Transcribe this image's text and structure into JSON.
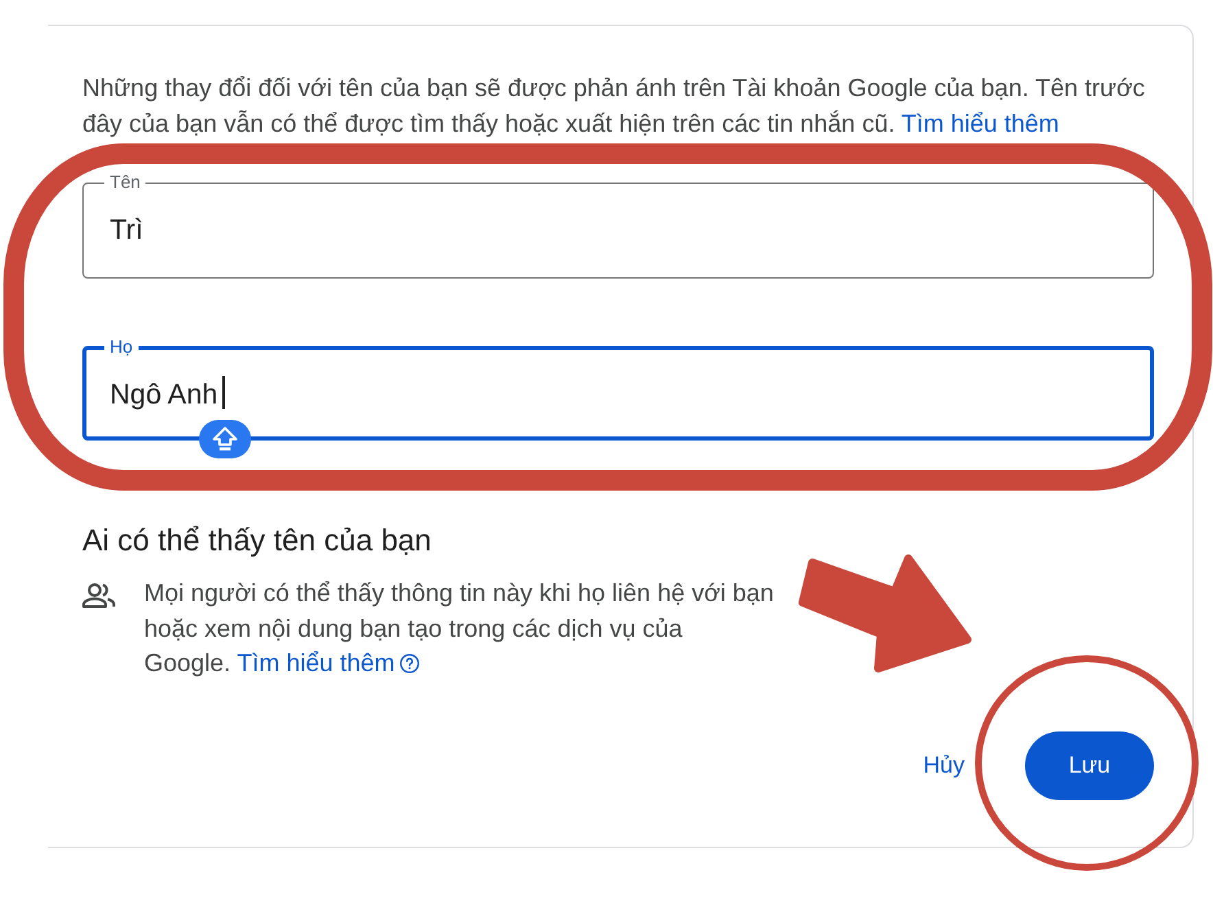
{
  "notice": {
    "text": "Những thay đổi đối với tên của bạn sẽ được phản ánh trên Tài khoản Google của bạn. Tên trước đây của bạn vẫn có thể được tìm thấy hoặc xuất hiện trên các tin nhắn cũ.",
    "link": "Tìm hiểu thêm"
  },
  "fields": [
    {
      "label": "Tên",
      "value": "Trì",
      "focused": false
    },
    {
      "label": "Họ",
      "value": "Ngô Anh",
      "focused": true
    }
  ],
  "visibility": {
    "title": "Ai có thể thấy tên của bạn",
    "text": "Mọi người có thể thấy thông tin này khi họ liên hệ với bạn hoặc xem nội dung bạn tạo trong các dịch vụ của Google.",
    "link": "Tìm hiểu thêm"
  },
  "buttons": [
    {
      "label": "Hủy",
      "kind": "text"
    },
    {
      "label": "Lưu",
      "kind": "filled"
    }
  ],
  "annotations": [
    {
      "kind": "outline"
    },
    {
      "kind": "arrow"
    },
    {
      "kind": "circle"
    }
  ]
}
